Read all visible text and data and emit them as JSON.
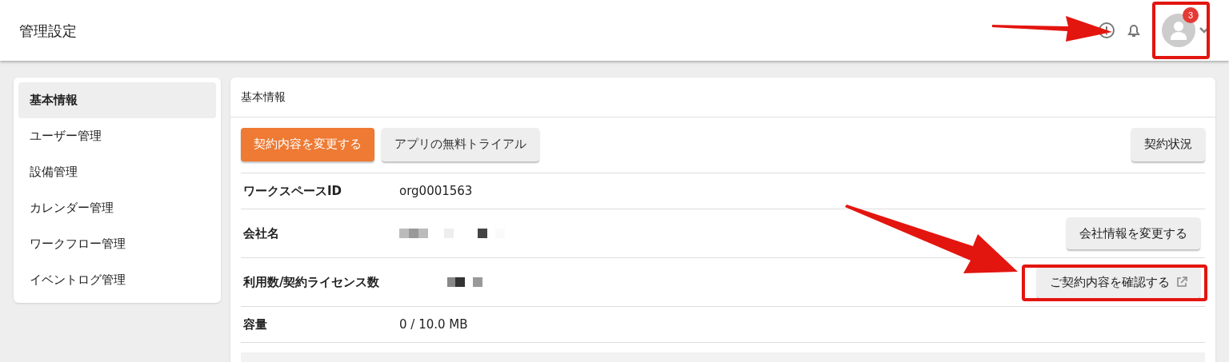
{
  "header": {
    "title": "管理設定",
    "badge": "3"
  },
  "sidebar": {
    "items": [
      {
        "label": "基本情報",
        "selected": true
      },
      {
        "label": "ユーザー管理",
        "selected": false
      },
      {
        "label": "設備管理",
        "selected": false
      },
      {
        "label": "カレンダー管理",
        "selected": false
      },
      {
        "label": "ワークフロー管理",
        "selected": false
      },
      {
        "label": "イベントログ管理",
        "selected": false
      }
    ]
  },
  "panel": {
    "title": "基本情報",
    "buttons": [
      {
        "label": "契約内容を変更する",
        "kind": "primary"
      },
      {
        "label": "アプリの無料トライアル",
        "kind": "default"
      }
    ],
    "status_button": "契約状況",
    "rows": [
      {
        "label": "ワークスペースID",
        "value": "org0001563",
        "kind": "text"
      },
      {
        "label": "会社名",
        "kind": "redacted",
        "action": "会社情報を変更する",
        "external": false
      },
      {
        "label": "利用数/契約ライセンス数",
        "kind": "redacted",
        "action": "ご契約内容を確認する",
        "external": true
      },
      {
        "label": "容量",
        "value": "0 / 10.0 MB",
        "kind": "text"
      }
    ]
  }
}
